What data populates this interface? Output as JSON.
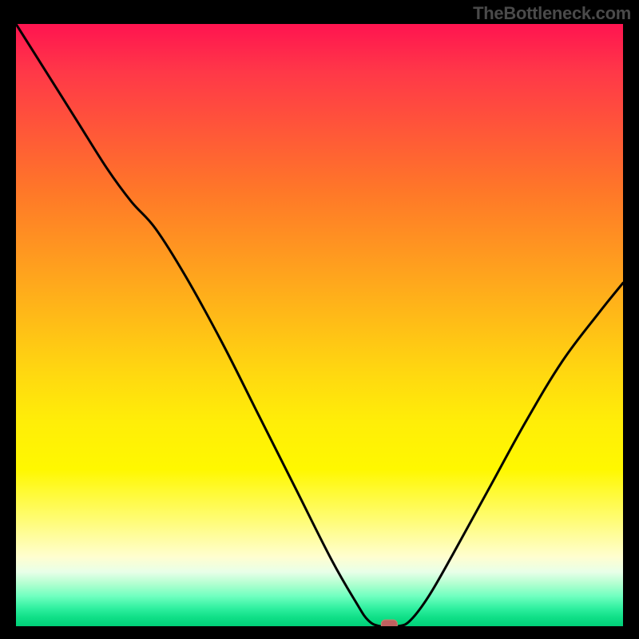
{
  "attribution": "TheBottleneck.com",
  "chart_data": {
    "type": "line",
    "title": "",
    "xlabel": "",
    "ylabel": "",
    "xlim": [
      0,
      100
    ],
    "ylim": [
      0,
      100
    ],
    "background_gradient": {
      "top_color": "#ff1450",
      "bottom_color": "#00d078",
      "description": "red-to-yellow-to-green vertical gradient (bottleneck severity)"
    },
    "curve_points": [
      {
        "x": 0,
        "y": 100
      },
      {
        "x": 5,
        "y": 92
      },
      {
        "x": 10,
        "y": 84
      },
      {
        "x": 15,
        "y": 76
      },
      {
        "x": 19,
        "y": 70.5
      },
      {
        "x": 23,
        "y": 66
      },
      {
        "x": 28,
        "y": 58
      },
      {
        "x": 34,
        "y": 47
      },
      {
        "x": 40,
        "y": 35
      },
      {
        "x": 46,
        "y": 23
      },
      {
        "x": 52,
        "y": 11
      },
      {
        "x": 56,
        "y": 4
      },
      {
        "x": 58,
        "y": 1
      },
      {
        "x": 60,
        "y": 0
      },
      {
        "x": 63,
        "y": 0
      },
      {
        "x": 65,
        "y": 1
      },
      {
        "x": 68,
        "y": 5
      },
      {
        "x": 72,
        "y": 12
      },
      {
        "x": 78,
        "y": 23
      },
      {
        "x": 84,
        "y": 34
      },
      {
        "x": 90,
        "y": 44
      },
      {
        "x": 96,
        "y": 52
      },
      {
        "x": 100,
        "y": 57
      }
    ],
    "marker": {
      "x": 61.5,
      "y": 0,
      "shape": "rounded_rect",
      "color": "#c16060"
    }
  }
}
